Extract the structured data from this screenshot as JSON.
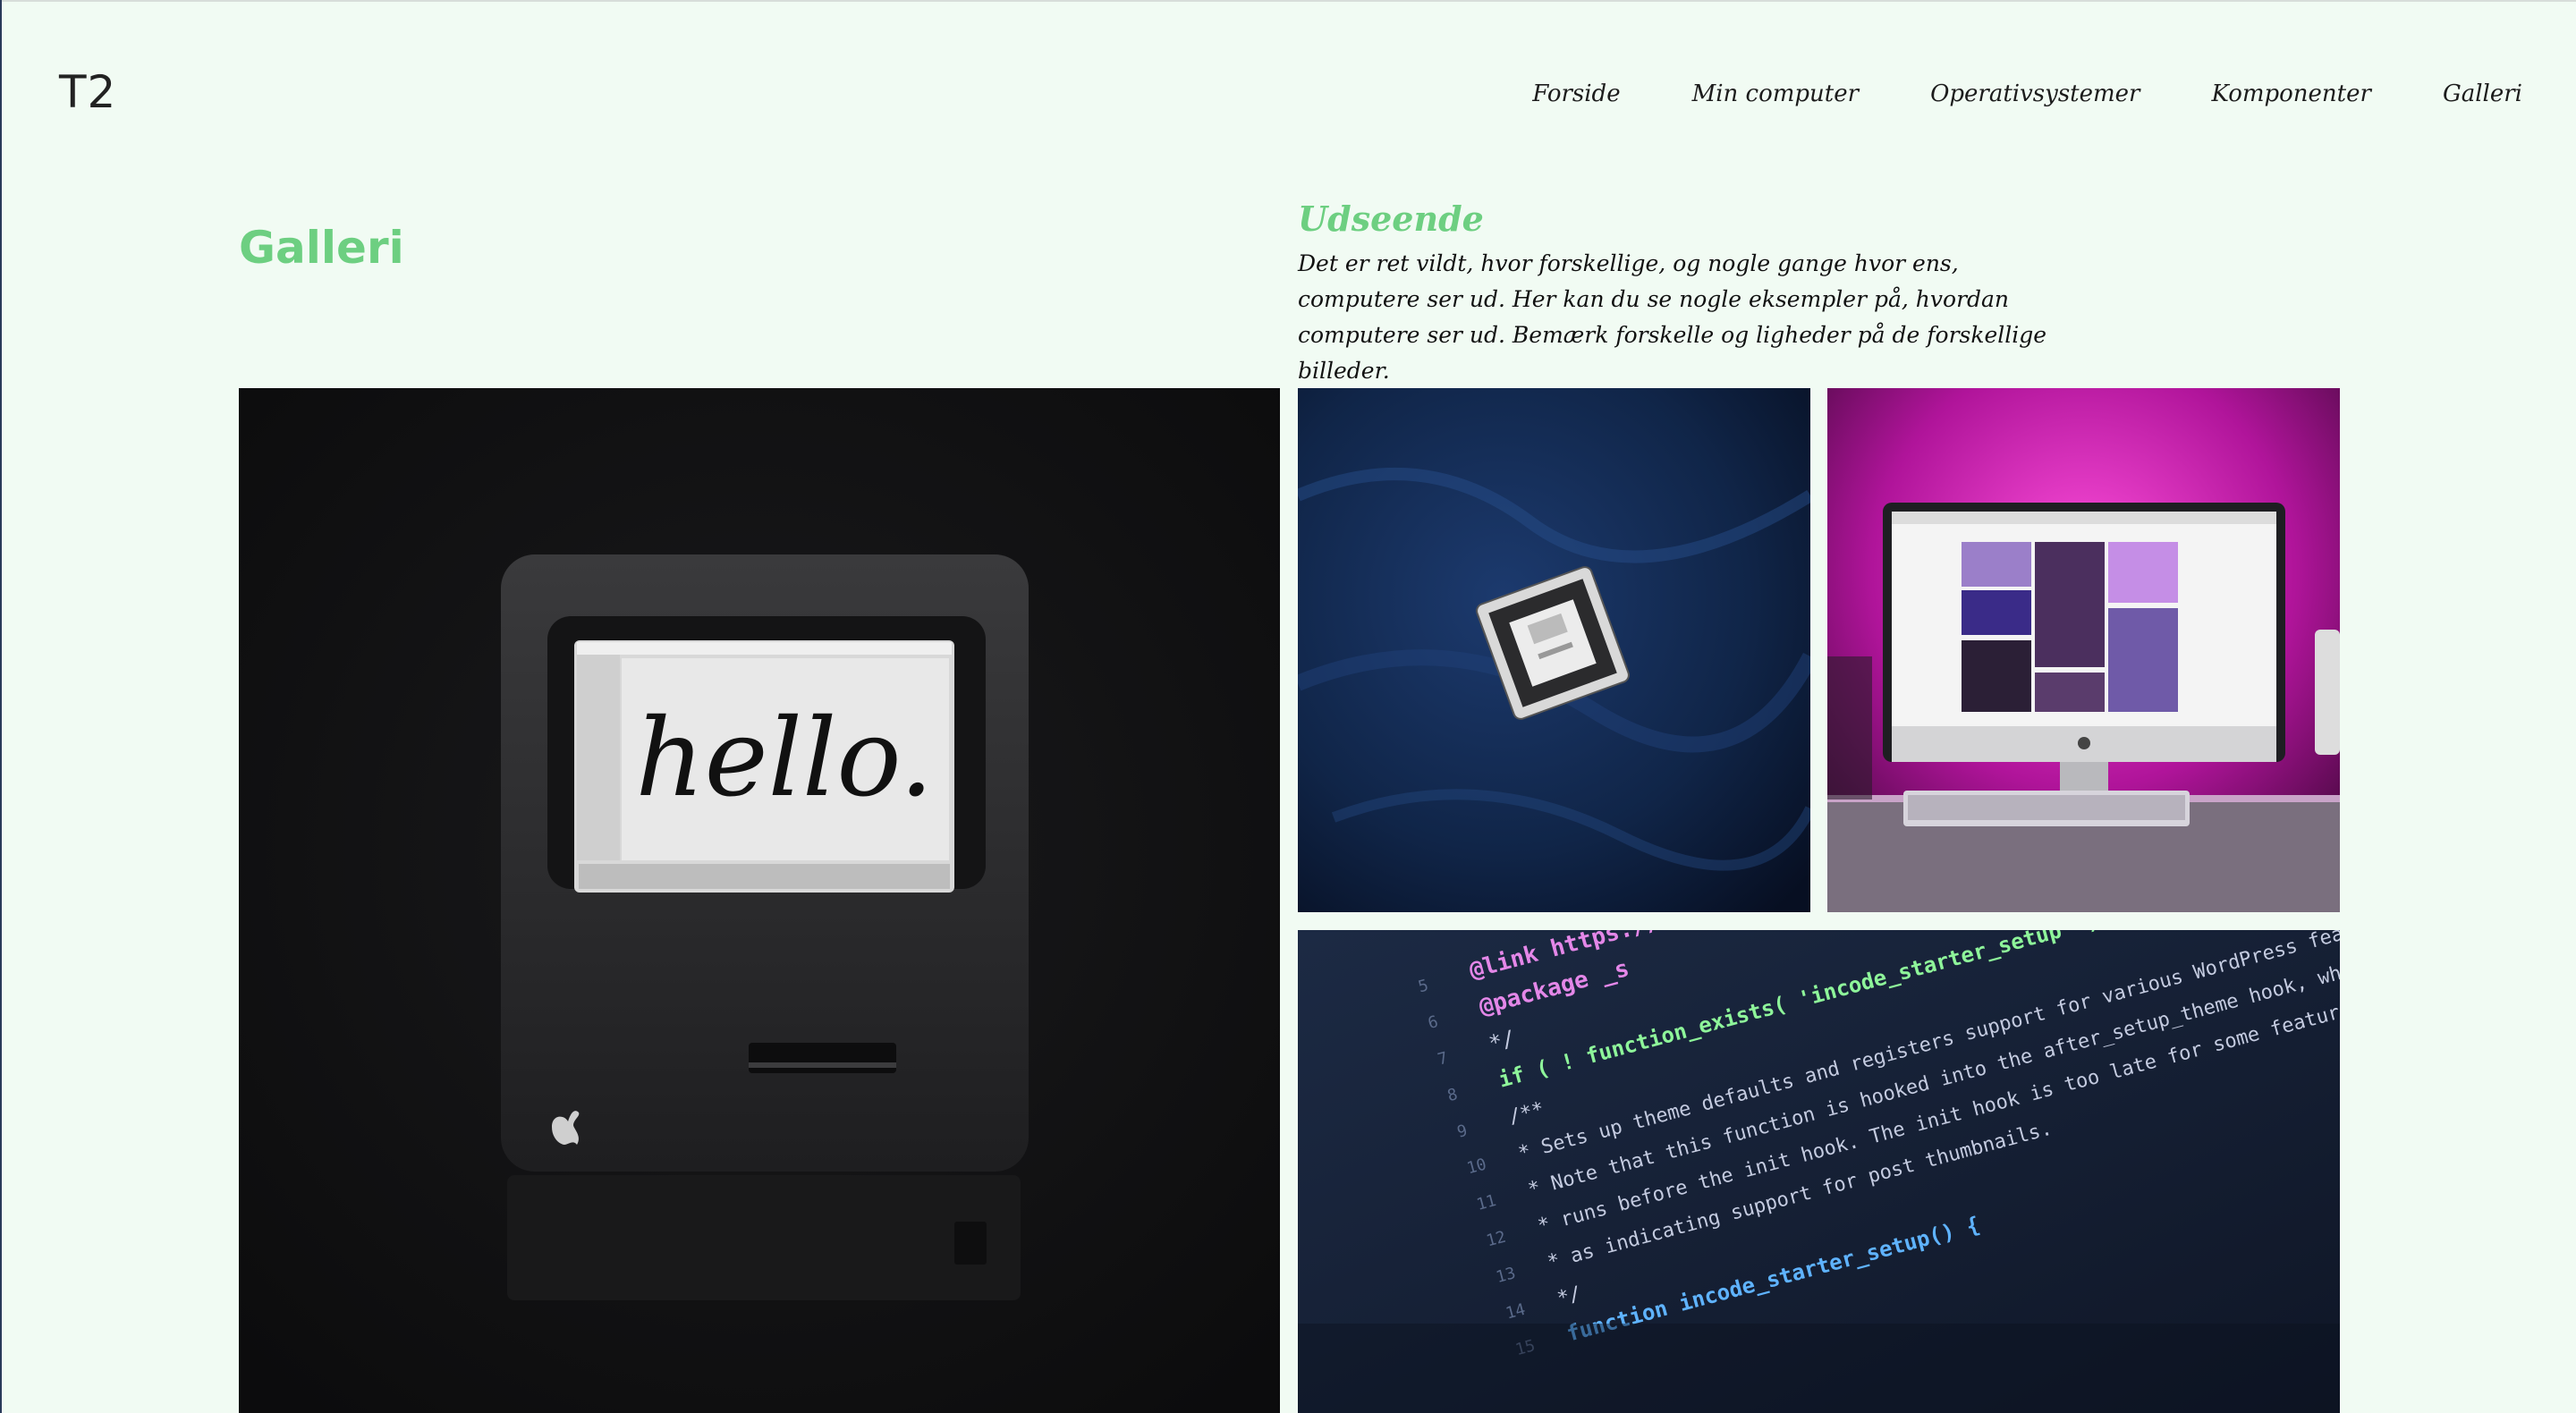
{
  "header": {
    "logo": "T2",
    "nav": [
      {
        "label": "Forside"
      },
      {
        "label": "Min computer"
      },
      {
        "label": "Operativsystemer"
      },
      {
        "label": "Komponenter"
      },
      {
        "label": "Galleri"
      }
    ]
  },
  "main": {
    "page_title": "Galleri",
    "section_title": "Udseende",
    "section_text": "Det er ret vildt, hvor forskellige, og nogle gange hvor ens, computere ser ud. Her kan du se nogle eksempler på, hvordan computere ser ud. Bemærk forskelle og ligheder på de forskellige billeder."
  },
  "gallery": {
    "mac_screen_text": "hello.",
    "code_lines": [
      "@link https://deve",
      "@package _s",
      "*/",
      "if ( ! function_exists( 'incode_starter_setup' ) ) :",
      "/**",
      "* Sets up theme defaults and registers support for various WordPress features.",
      "* Note that this function is hooked into the after_setup_theme hook, which",
      "* runs before the init hook. The init hook is too late for some features, such",
      "* as indicating support for post thumbnails.",
      "*/",
      "function incode_starter_setup() {"
    ],
    "line_numbers": [
      "5",
      "6",
      "7",
      "8",
      "9",
      "10",
      "11",
      "12",
      "13",
      "14",
      "15"
    ]
  },
  "colors": {
    "background": "#f1fbf3",
    "accent": "#6dcf81",
    "text": "#111111"
  }
}
